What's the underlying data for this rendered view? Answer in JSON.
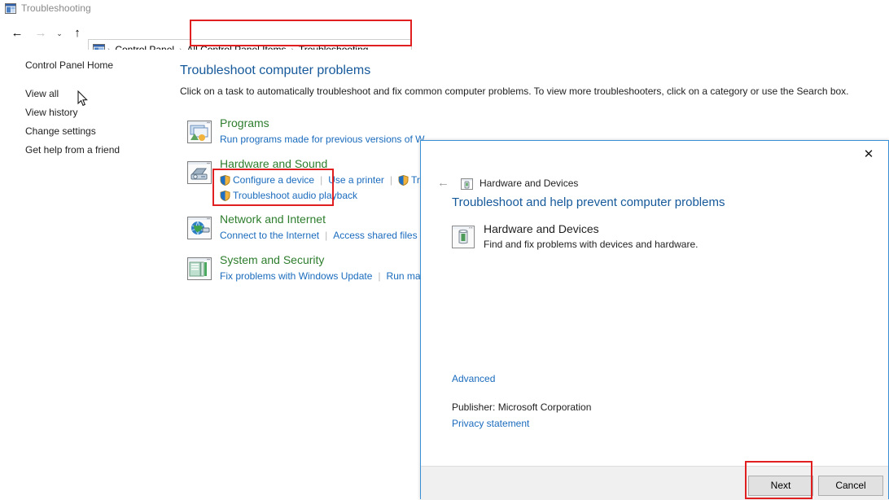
{
  "window": {
    "title": "Troubleshooting",
    "icon": "control-panel-icon"
  },
  "nav": {
    "back_glyph": "←",
    "forward_glyph": "→",
    "recent_glyph": "⌄",
    "up_glyph": "↑",
    "breadcrumbs": [
      {
        "label": "Control Panel"
      },
      {
        "label": "All Control Panel Items"
      },
      {
        "label": "Troubleshooting"
      }
    ],
    "separator": "›"
  },
  "sidebar": {
    "home_label": "Control Panel Home",
    "items": [
      {
        "label": "View all"
      },
      {
        "label": "View history"
      },
      {
        "label": "Change settings"
      },
      {
        "label": "Get help from a friend"
      }
    ]
  },
  "main": {
    "title": "Troubleshoot computer problems",
    "subtitle": "Click on a task to automatically troubleshoot and fix common computer problems. To view more troubleshooters, click on a category or use the Search box.",
    "categories": [
      {
        "icon": "programs-icon",
        "title": "Programs",
        "links_row1": [
          {
            "label": "Run programs made for previous versions of W",
            "shield": false
          }
        ],
        "links_row2": []
      },
      {
        "icon": "printer-icon",
        "title": "Hardware and Sound",
        "links_row1": [
          {
            "label": "Configure a device",
            "shield": true
          },
          {
            "label": "Use a printer",
            "shield": false
          },
          {
            "label": "Tr",
            "shield": true
          }
        ],
        "links_row2": [
          {
            "label": "Troubleshoot audio playback",
            "shield": true
          }
        ]
      },
      {
        "icon": "network-globe-icon",
        "title": "Network and Internet",
        "links_row1": [
          {
            "label": "Connect to the Internet",
            "shield": false
          },
          {
            "label": "Access shared files a",
            "shield": false
          }
        ],
        "links_row2": []
      },
      {
        "icon": "system-security-icon",
        "title": "System and Security",
        "links_row1": [
          {
            "label": "Fix problems with Windows Update",
            "shield": false
          },
          {
            "label": "Run mai",
            "shield": false
          }
        ],
        "links_row2": []
      }
    ]
  },
  "dialog": {
    "close_glyph": "✕",
    "back_glyph": "←",
    "nav_title": "Hardware and Devices",
    "nav_icon": "hardware-devices-small-icon",
    "heading": "Troubleshoot and help prevent computer problems",
    "item": {
      "icon": "hardware-devices-icon",
      "title": "Hardware and Devices",
      "description": "Find and fix problems with devices and hardware."
    },
    "advanced_label": "Advanced",
    "publisher_label": "Publisher:  Microsoft Corporation",
    "privacy_label": "Privacy statement",
    "buttons": {
      "next": "Next",
      "cancel": "Cancel"
    }
  },
  "annotations": {
    "highlight_color": "#e02020",
    "boxes": [
      {
        "name": "breadcrumb-highlight"
      },
      {
        "name": "hardware-and-sound-highlight"
      },
      {
        "name": "next-button-highlight"
      }
    ]
  }
}
